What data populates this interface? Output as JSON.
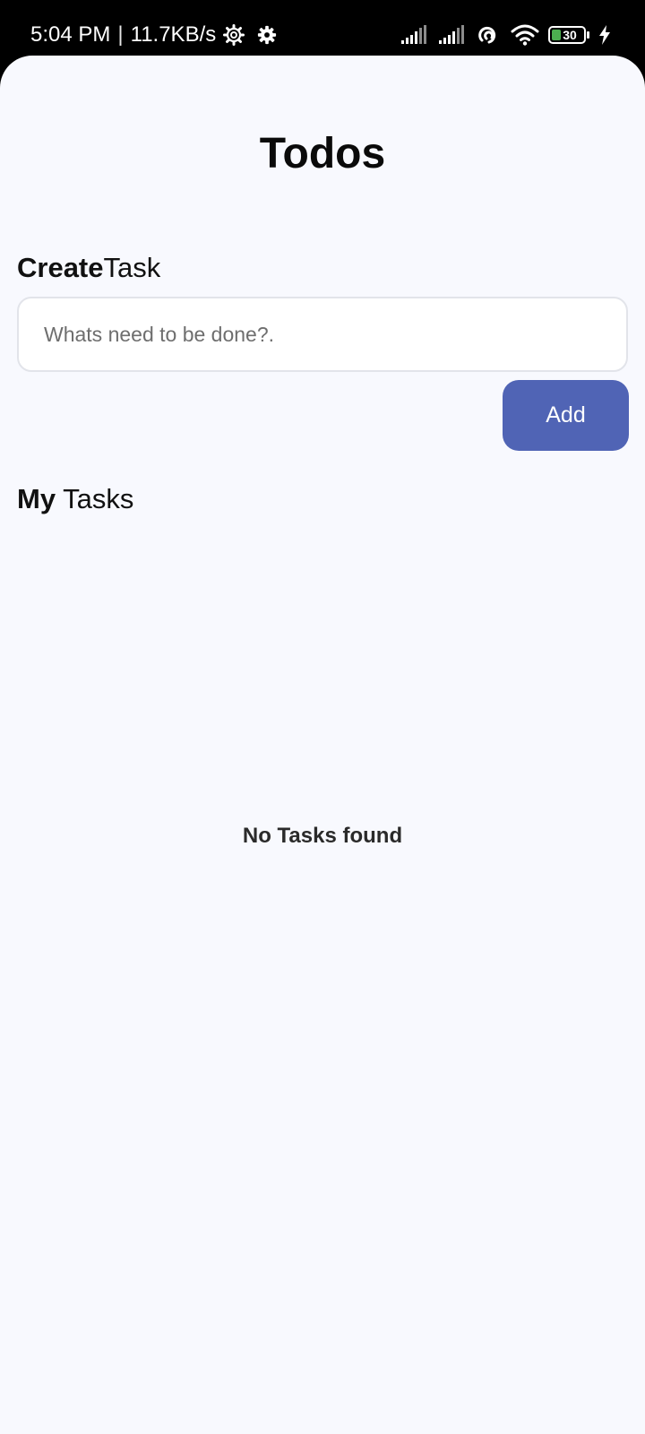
{
  "status_bar": {
    "time": "5:04 PM",
    "separator": "|",
    "net_speed": "11.7KB/s",
    "battery_level": "30",
    "battery_fill_color": "#4caf50",
    "icons": [
      "gear-outline-icon",
      "gear-icon",
      "signal-icon",
      "signal-icon",
      "hotspot-icon",
      "wifi-icon",
      "battery-icon",
      "charging-icon"
    ]
  },
  "app": {
    "title": "Todos",
    "create": {
      "heading_bold": "Create",
      "heading_rest": "Task",
      "input_placeholder": "Whats need to be done?.",
      "input_value": "",
      "add_label": "Add"
    },
    "tasks": {
      "heading_bold": "My",
      "heading_rest": " Tasks",
      "items": [],
      "empty_message": "No Tasks found"
    }
  },
  "colors": {
    "background": "#f8f9fe",
    "accent": "#5064b5",
    "status_bar": "#000000"
  }
}
